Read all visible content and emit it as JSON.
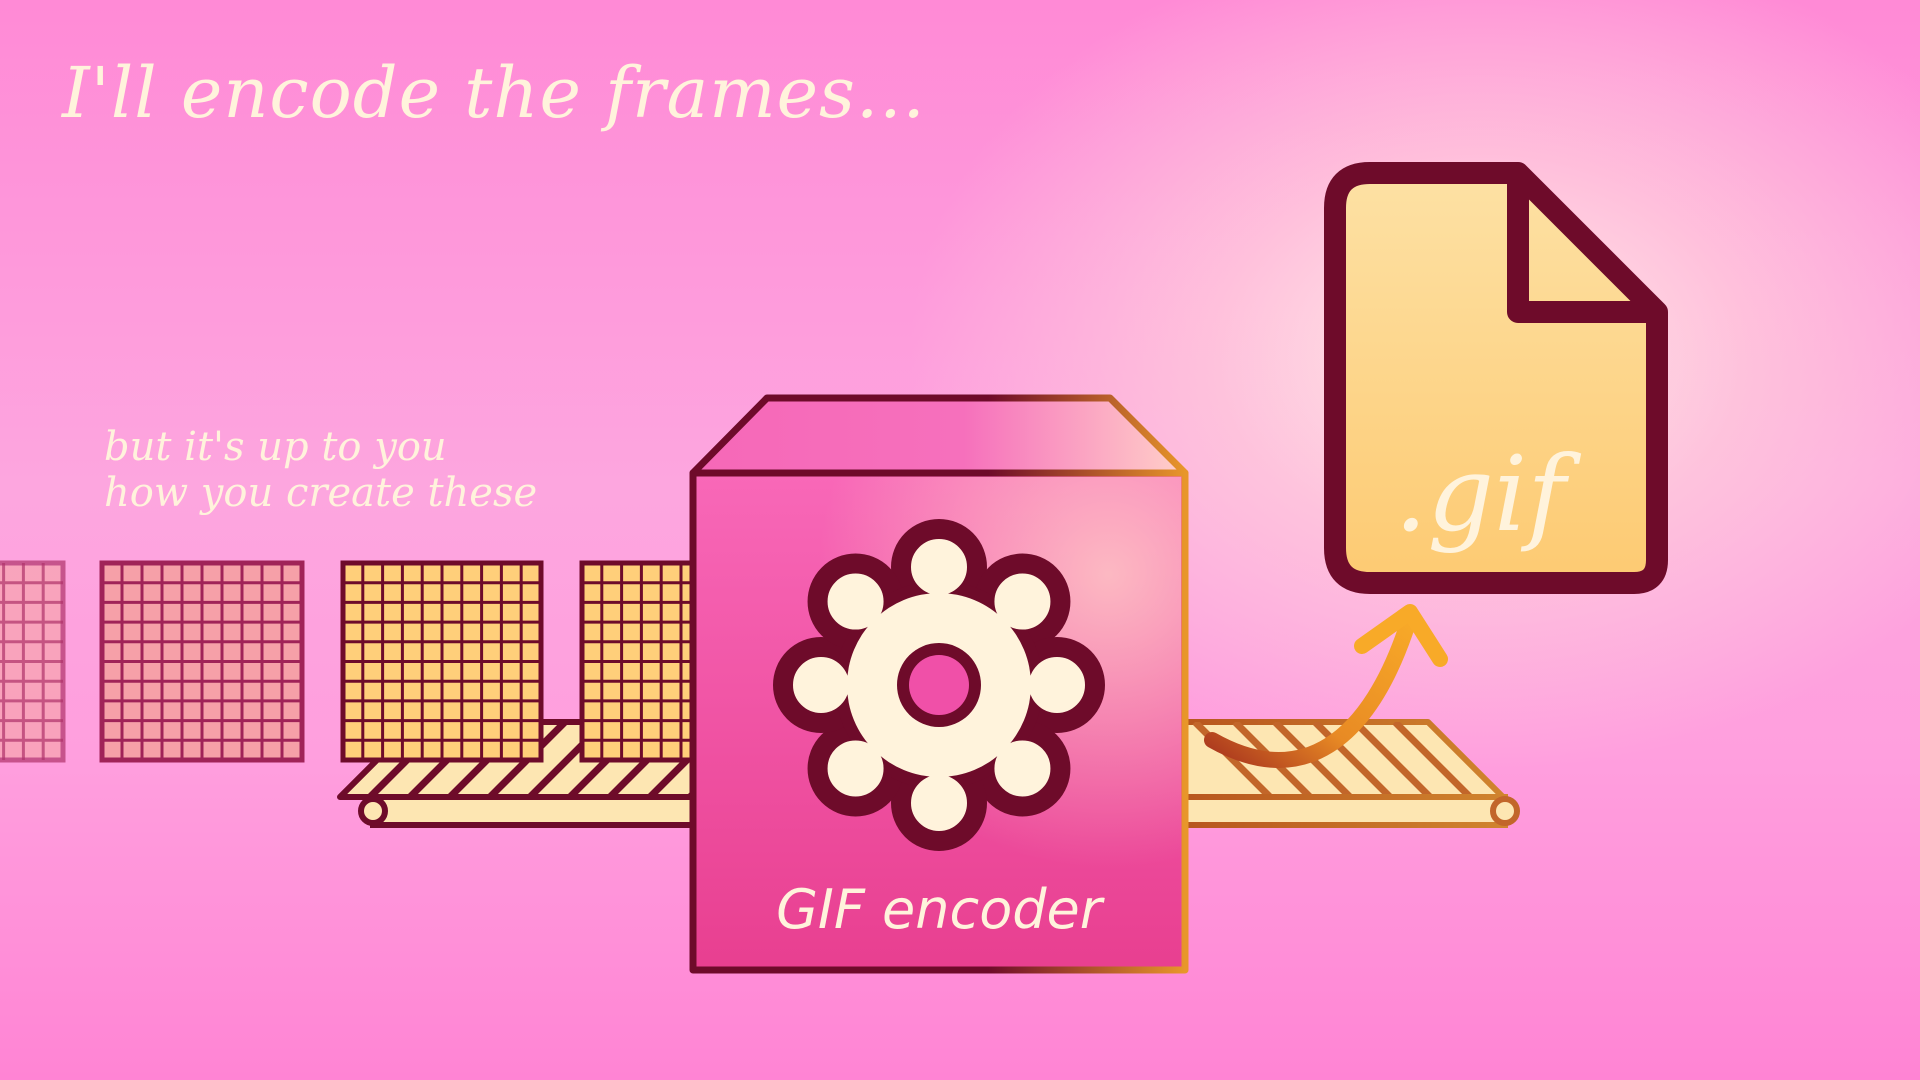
{
  "headline": "I'll encode the frames...",
  "subtext": {
    "line1": "but it's up to you",
    "line2": "how you create these"
  },
  "encoder": {
    "label": "GIF encoder",
    "icon": "gear-icon"
  },
  "output_file": {
    "extension": ".gif",
    "icon": "file-icon"
  },
  "frames": {
    "count": 4,
    "grid_cells": 10
  },
  "colors": {
    "outline": "#6e0b2a",
    "cream": "#fff3dc",
    "frame_yellow": "#ffcf7a",
    "frame_pink": "#f6a0a8",
    "box_pink": "#f05bb0",
    "arrow_orange": "#f7a325"
  }
}
